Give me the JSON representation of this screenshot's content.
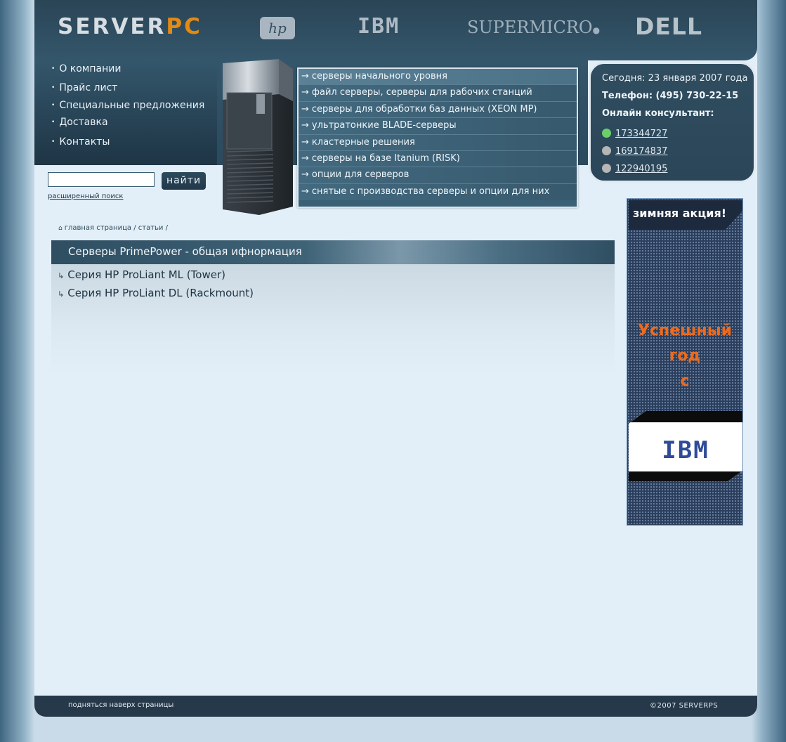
{
  "header": {
    "logo_main": "SERVER",
    "logo_accent": "PC",
    "brands": [
      "hp",
      "IBM",
      "SUPERMICRO",
      "DELL"
    ]
  },
  "nav": {
    "items": [
      {
        "label": "О компании"
      },
      {
        "label": "Прайс лист"
      },
      {
        "label": "Специальные предложения"
      },
      {
        "label": "Доставка"
      },
      {
        "label": "Контакты"
      }
    ]
  },
  "categories": [
    {
      "label": "серверы начального уровня"
    },
    {
      "label": "файл серверы, серверы для рабочих станций"
    },
    {
      "label": "серверы для обработки баз данных (XEON MP)"
    },
    {
      "label": "ультратонкие BLADE-серверы"
    },
    {
      "label": "кластерные решения"
    },
    {
      "label": "серверы на базе Itanium (RISK)"
    },
    {
      "label": "опции для серверов"
    },
    {
      "label": "снятые с производства серверы и опции для них"
    }
  ],
  "info": {
    "date": "Сегодня: 23 января 2007 года",
    "phone": "Телефон: (495) 730-22-15",
    "consultant": "Онлайн консультант:",
    "icq": [
      {
        "number": "173344727",
        "status": "online",
        "color": "#6ad06a"
      },
      {
        "number": "169174837",
        "status": "offline",
        "color": "#b6b6b6"
      },
      {
        "number": "122940195",
        "status": "offline",
        "color": "#b6b6b6"
      }
    ]
  },
  "search": {
    "value": "",
    "button": "найти",
    "advanced": "расширенный поиск"
  },
  "breadcrumb": {
    "home": "главная страница",
    "section": "статьи"
  },
  "content": {
    "title": "Серверы PrimePower - общая ифнормация",
    "articles": [
      {
        "label": "Серия HP ProLiant ML (Tower)"
      },
      {
        "label": "Серия HP ProLiant DL (Rackmount)"
      }
    ]
  },
  "banner": {
    "top": "зимняя акция!",
    "line1": "Успешный",
    "line2": "год",
    "line3": "с",
    "brand": "IBM"
  },
  "footer": {
    "to_top": "подняться наверх страницы",
    "copyright": "©2007 SERVERPS"
  }
}
